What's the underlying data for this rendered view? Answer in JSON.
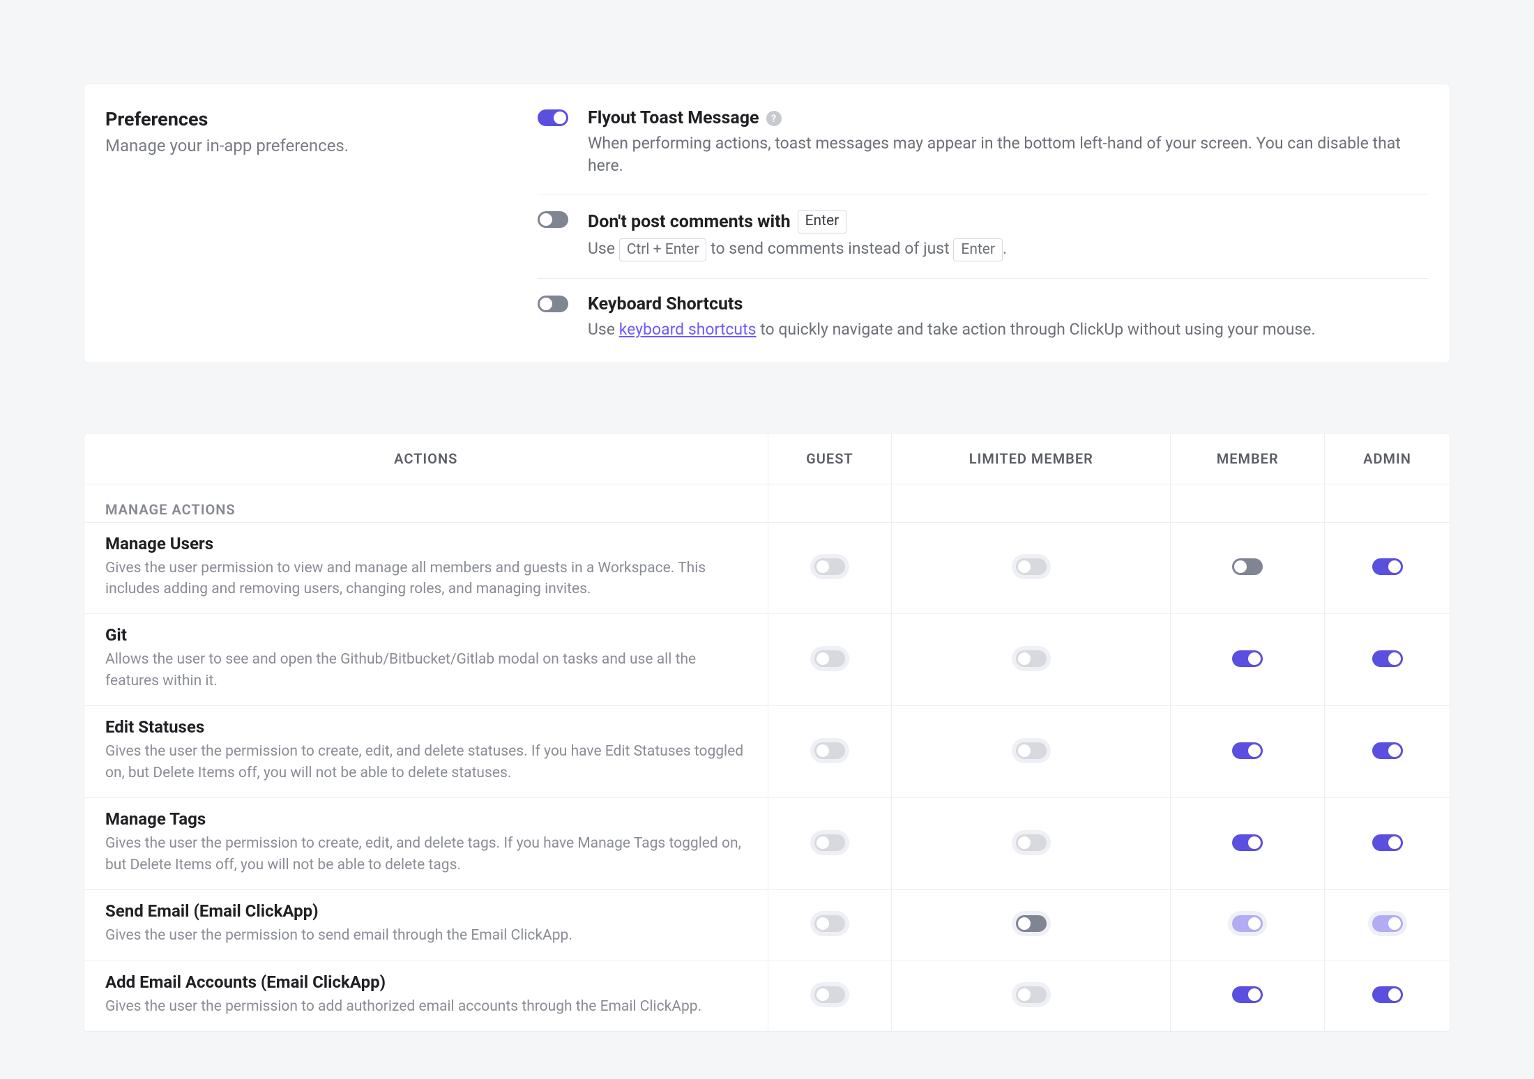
{
  "prefs": {
    "title": "Preferences",
    "subtitle": "Manage your in-app preferences.",
    "items": [
      {
        "toggle": "on",
        "heading": "Flyout Toast Message",
        "help": true,
        "desc_html": "When performing actions, toast messages may appear in the bottom left-hand of your screen. You can disable that here."
      },
      {
        "toggle": "off-dark",
        "heading_parts": [
          "Don't post comments with",
          {
            "kbd": "Enter"
          }
        ],
        "desc_parts": [
          "Use ",
          {
            "kbd": "Ctrl + Enter"
          },
          " to send comments instead of just ",
          {
            "kbd": "Enter"
          },
          "."
        ]
      },
      {
        "toggle": "off-dark",
        "heading": "Keyboard Shortcuts",
        "desc_parts": [
          "Use ",
          {
            "link": "keyboard shortcuts"
          },
          " to quickly navigate and take action through ClickUp without using your mouse."
        ]
      }
    ]
  },
  "permissions": {
    "columns": [
      "ACTIONS",
      "GUEST",
      "LIMITED MEMBER",
      "MEMBER",
      "ADMIN"
    ],
    "section_label": "MANAGE ACTIONS",
    "rows": [
      {
        "title": "Manage Users",
        "desc": "Gives the user permission to view and manage all members and guests in a Workspace. This includes adding and removing users, changing roles, and managing invites.",
        "states": [
          "off-light-halo",
          "off-light-halo",
          "off-dark",
          "on"
        ]
      },
      {
        "title": "Git",
        "desc": "Allows the user to see and open the Github/Bitbucket/Gitlab modal on tasks and use all the features within it.",
        "states": [
          "off-light-halo",
          "off-light-halo",
          "on",
          "on"
        ]
      },
      {
        "title": "Edit Statuses",
        "desc": "Gives the user the permission to create, edit, and delete statuses. If you have Edit Statuses toggled on, but Delete Items off, you will not be able to delete statuses.",
        "states": [
          "off-light-halo",
          "off-light-halo",
          "on",
          "on"
        ]
      },
      {
        "title": "Manage Tags",
        "desc": "Gives the user the permission to create, edit, and delete tags. If you have Manage Tags toggled on, but Delete Items off, you will not be able to delete tags.",
        "states": [
          "off-light-halo",
          "off-light-halo",
          "on",
          "on"
        ]
      },
      {
        "title": "Send Email (Email ClickApp)",
        "desc": "Gives the user the permission to send email through the Email ClickApp.",
        "states": [
          "off-light-halo",
          "off-dark-halo",
          "on-faded-halo",
          "on-faded-halo"
        ]
      },
      {
        "title": "Add Email Accounts (Email ClickApp)",
        "desc": "Gives the user the permission to add authorized email accounts through the Email ClickApp.",
        "states": [
          "off-light-halo",
          "off-light-halo",
          "on",
          "on"
        ]
      }
    ]
  }
}
